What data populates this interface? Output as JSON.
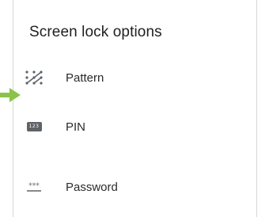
{
  "dialog": {
    "title": "Screen lock options",
    "options": [
      {
        "label": "Pattern",
        "icon": "pattern-icon"
      },
      {
        "label": "PIN",
        "icon": "pin-icon",
        "icon_text": "123"
      },
      {
        "label": "Password",
        "icon": "password-icon",
        "icon_text": "***"
      }
    ]
  },
  "colors": {
    "pointer_arrow": "#8bc34a",
    "icon": "#5f6368",
    "text": "#202124"
  }
}
